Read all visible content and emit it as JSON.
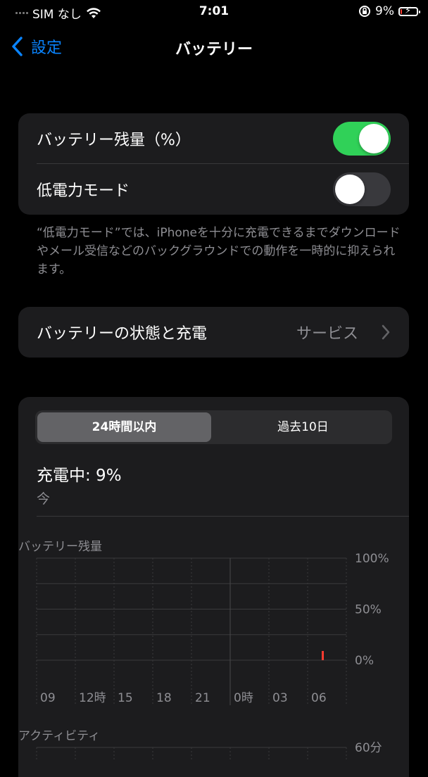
{
  "status_bar": {
    "carrier": "SIM なし",
    "time": "7:01",
    "battery_percent": "9%",
    "battery_level": 0.09,
    "charging": true
  },
  "nav": {
    "back_label": "設定",
    "title": "バッテリー"
  },
  "settings": {
    "battery_percentage_label": "バッテリー残量（%）",
    "battery_percentage_on": true,
    "low_power_label": "低電力モード",
    "low_power_on": false,
    "footnote": "“低電力モード”では、iPhoneを十分に充電できるまでダウンロードやメール受信などのバックグラウンドでの動作を一時的に抑えられます。"
  },
  "health": {
    "label": "バッテリーの状態と充電",
    "value": "サービス"
  },
  "usage": {
    "tabs": [
      "24時間以内",
      "過去10日"
    ],
    "selected_tab": 0,
    "charge_status": "充電中: 9%",
    "charge_time": "今"
  },
  "chart_data": [
    {
      "type": "bar",
      "title": "バッテリー残量",
      "x_ticks": [
        "09",
        "12時",
        "15",
        "18",
        "21",
        "0時",
        "03",
        "06"
      ],
      "y_ticks": [
        "100%",
        "50%",
        "0%"
      ],
      "ylim": [
        0,
        100
      ],
      "series": [
        {
          "values": [
            {
              "x": "06",
              "y": 9,
              "color": "#ff3b30"
            }
          ]
        }
      ]
    },
    {
      "type": "bar",
      "title": "アクティビティ",
      "y_ticks": [
        "60分"
      ]
    }
  ],
  "colors": {
    "accent": "#0a84ff",
    "toggle_on": "#30d158",
    "low_battery": "#ff3b30"
  }
}
